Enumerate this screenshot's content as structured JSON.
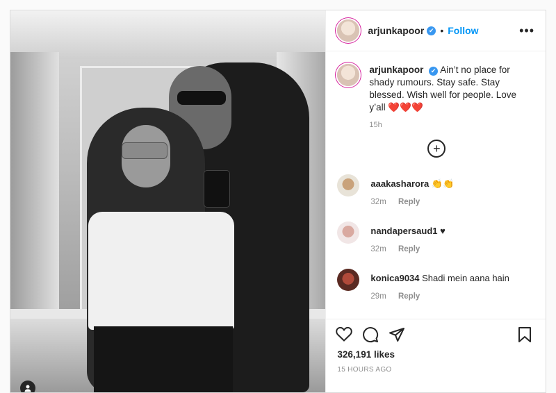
{
  "post": {
    "username": "arjunkapoor",
    "follow_label": "Follow",
    "separator": "•",
    "more_label": "•••",
    "verified_glyph": "✔",
    "caption": {
      "username": "arjunkapoor",
      "text": "Ain’t no place for shady rumours. Stay safe. Stay blessed. Wish well for people. Love y’all ❤️❤️❤️",
      "time": "15h"
    },
    "load_more_glyph": "+",
    "comments": [
      {
        "username": "aaakasharora",
        "text": "👏👏",
        "time": "32m",
        "reply": "Reply"
      },
      {
        "username": "nandapersaud1",
        "text": "♥",
        "time": "32m",
        "reply": "Reply"
      },
      {
        "username": "konica9034",
        "text": "Shadi mein aana hain",
        "time": "29m",
        "reply": "Reply"
      }
    ],
    "likes": "326,191 likes",
    "posted_ago": "15 HOURS AGO"
  },
  "icons": [
    "heart-icon",
    "comment-icon",
    "share-icon",
    "bookmark-icon",
    "user-tag-icon",
    "verified-icon",
    "more-options-icon",
    "load-more-comments-icon"
  ],
  "colors": {
    "accent": "#0095f6",
    "verified": "#3897f0",
    "text": "#262626",
    "muted": "#8e8e8e"
  }
}
